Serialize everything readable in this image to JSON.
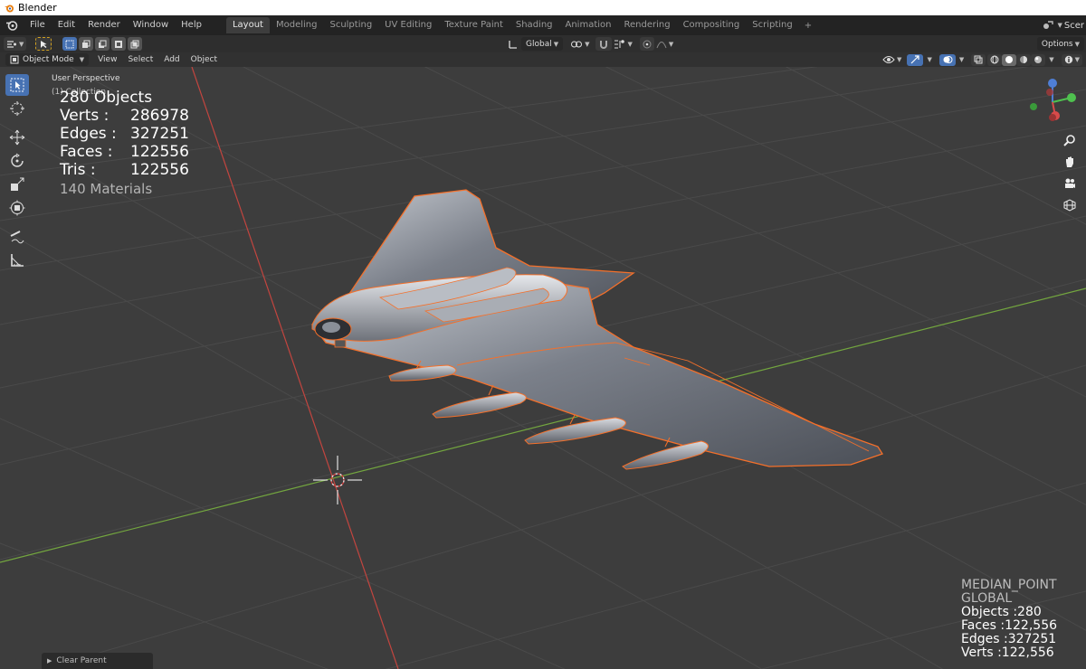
{
  "window": {
    "title": "Blender"
  },
  "menus": [
    "File",
    "Edit",
    "Render",
    "Window",
    "Help"
  ],
  "workspaces": [
    "Layout",
    "Modeling",
    "Sculpting",
    "UV Editing",
    "Texture Paint",
    "Shading",
    "Animation",
    "Rendering",
    "Compositing",
    "Scripting"
  ],
  "active_workspace": "Layout",
  "topbar": {
    "scene_label": "Scer",
    "add_workspace": "+"
  },
  "tool_header": {
    "orientation": "Global",
    "options": "Options"
  },
  "viewport_header": {
    "mode": "Object Mode",
    "menus": [
      "View",
      "Select",
      "Add",
      "Object"
    ]
  },
  "overlay": {
    "perspective": "User Perspective",
    "collection": "(1) Collection",
    "stats": {
      "objects": "280 Objects",
      "verts_label": "Verts :",
      "verts": "286978",
      "edges_label": "Edges :",
      "edges": "327251",
      "faces_label": "Faces :",
      "faces": "122556",
      "tris_label": "Tris :",
      "tris": "122556",
      "materials": "140 Materials"
    }
  },
  "corner_stats": {
    "pivot": "MEDIAN_POINT",
    "orientation": "GLOBAL",
    "objects": "Objects :280",
    "faces": "Faces :122,556",
    "edges": "Edges :327251",
    "verts": "Verts :122,556"
  },
  "last_operator": "Clear Parent",
  "colors": {
    "accent": "#4772b3",
    "selection": "#f5702a",
    "axis_x": "#c2453f",
    "axis_y": "#73a63f",
    "background": "#3d3d3d"
  },
  "icons": {
    "left_toolbar": [
      "select-box-icon",
      "cursor-icon",
      "move-icon",
      "rotate-icon",
      "scale-icon",
      "transform-icon",
      "annotate-icon",
      "measure-icon"
    ],
    "nav": [
      "zoom-icon",
      "pan-hand-icon",
      "camera-icon",
      "grid-view-icon"
    ]
  }
}
